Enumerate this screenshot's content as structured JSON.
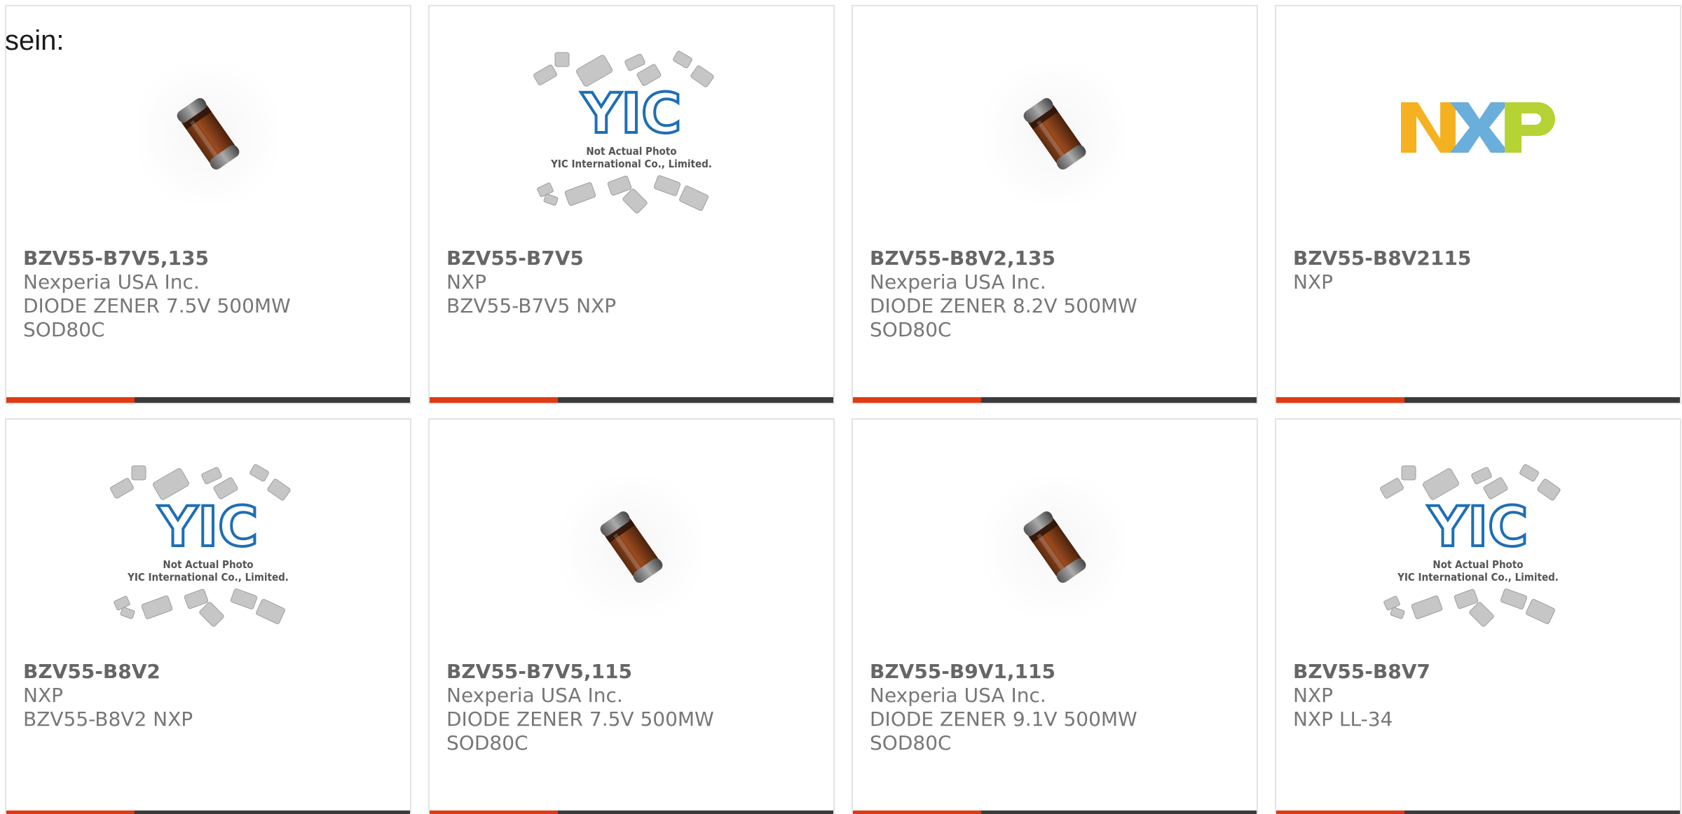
{
  "intro_text": "sein:",
  "colors": {
    "accent_bar": "#e03a14",
    "dark_bar": "#3b3b3b",
    "yic_logo": "#1e6fb5",
    "nxp_yellow": "#f5b120",
    "nxp_blue": "#6aaedc",
    "nxp_green": "#b5d334"
  },
  "image_captions": {
    "yic_logo": "YIC",
    "yic_line1": "Not Actual Photo",
    "yic_line2": "YIC International Co., Limited.",
    "nxp_logo": "NXP"
  },
  "products": [
    {
      "image": "diode-photo",
      "part_number": "BZV55-B7V5,135",
      "manufacturer": "Nexperia USA Inc.",
      "description": "DIODE ZENER 7.5V 500MW",
      "package": "SOD80C"
    },
    {
      "image": "yic-placeholder",
      "part_number": "BZV55-B7V5",
      "manufacturer": "NXP",
      "description": "BZV55-B7V5 NXP",
      "package": ""
    },
    {
      "image": "diode-photo",
      "part_number": "BZV55-B8V2,135",
      "manufacturer": "Nexperia USA Inc.",
      "description": "DIODE ZENER 8.2V 500MW",
      "package": "SOD80C"
    },
    {
      "image": "nxp-logo",
      "part_number": "BZV55-B8V2115",
      "manufacturer": "NXP",
      "description": "",
      "package": ""
    },
    {
      "image": "yic-placeholder",
      "part_number": "BZV55-B8V2",
      "manufacturer": "NXP",
      "description": "BZV55-B8V2 NXP",
      "package": ""
    },
    {
      "image": "diode-photo",
      "part_number": "BZV55-B7V5,115",
      "manufacturer": "Nexperia USA Inc.",
      "description": "DIODE ZENER 7.5V 500MW",
      "package": "SOD80C"
    },
    {
      "image": "diode-photo",
      "part_number": "BZV55-B9V1,115",
      "manufacturer": "Nexperia USA Inc.",
      "description": "DIODE ZENER 9.1V 500MW",
      "package": "SOD80C"
    },
    {
      "image": "yic-placeholder",
      "part_number": "BZV55-B8V7",
      "manufacturer": "NXP",
      "description": "NXP LL-34",
      "package": ""
    }
  ]
}
